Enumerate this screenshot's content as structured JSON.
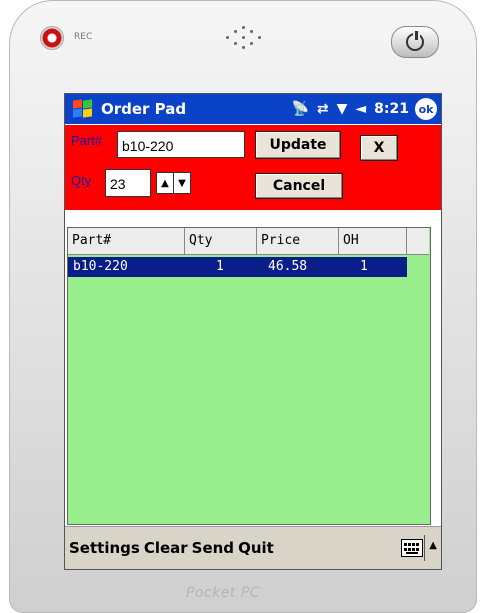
{
  "device": {
    "rec_label": "REC",
    "brand": "Pocket PC"
  },
  "taskbar": {
    "app_title": "Order Pad",
    "time": "8:21",
    "ok_label": "ok"
  },
  "form": {
    "part_label": "Part#",
    "part_value": "b10-220",
    "qty_label": "Qty",
    "qty_value": "23",
    "update_button": "Update",
    "close_button": "X",
    "cancel_button": "Cancel"
  },
  "grid": {
    "headers": [
      "Part#",
      "Qty",
      "Price",
      "OH"
    ],
    "rows": [
      {
        "part": "b10-220",
        "qty": "1",
        "price": "46.58",
        "oh": "1"
      }
    ]
  },
  "menubar": {
    "items": [
      "Settings",
      "Clear",
      "Send",
      "Quit"
    ]
  },
  "colors": {
    "taskbar": "#0b43c8",
    "form_bg": "#ff0000",
    "grid_bg": "#98ed8c",
    "selection": "#0a1e8a"
  },
  "icons": {
    "taskbar": [
      "windows-start-icon",
      "antenna-icon",
      "sync-arrows-icon",
      "signal-icon",
      "speaker-icon"
    ],
    "menubar": [
      "keyboard-icon",
      "up-arrow-icon"
    ]
  }
}
